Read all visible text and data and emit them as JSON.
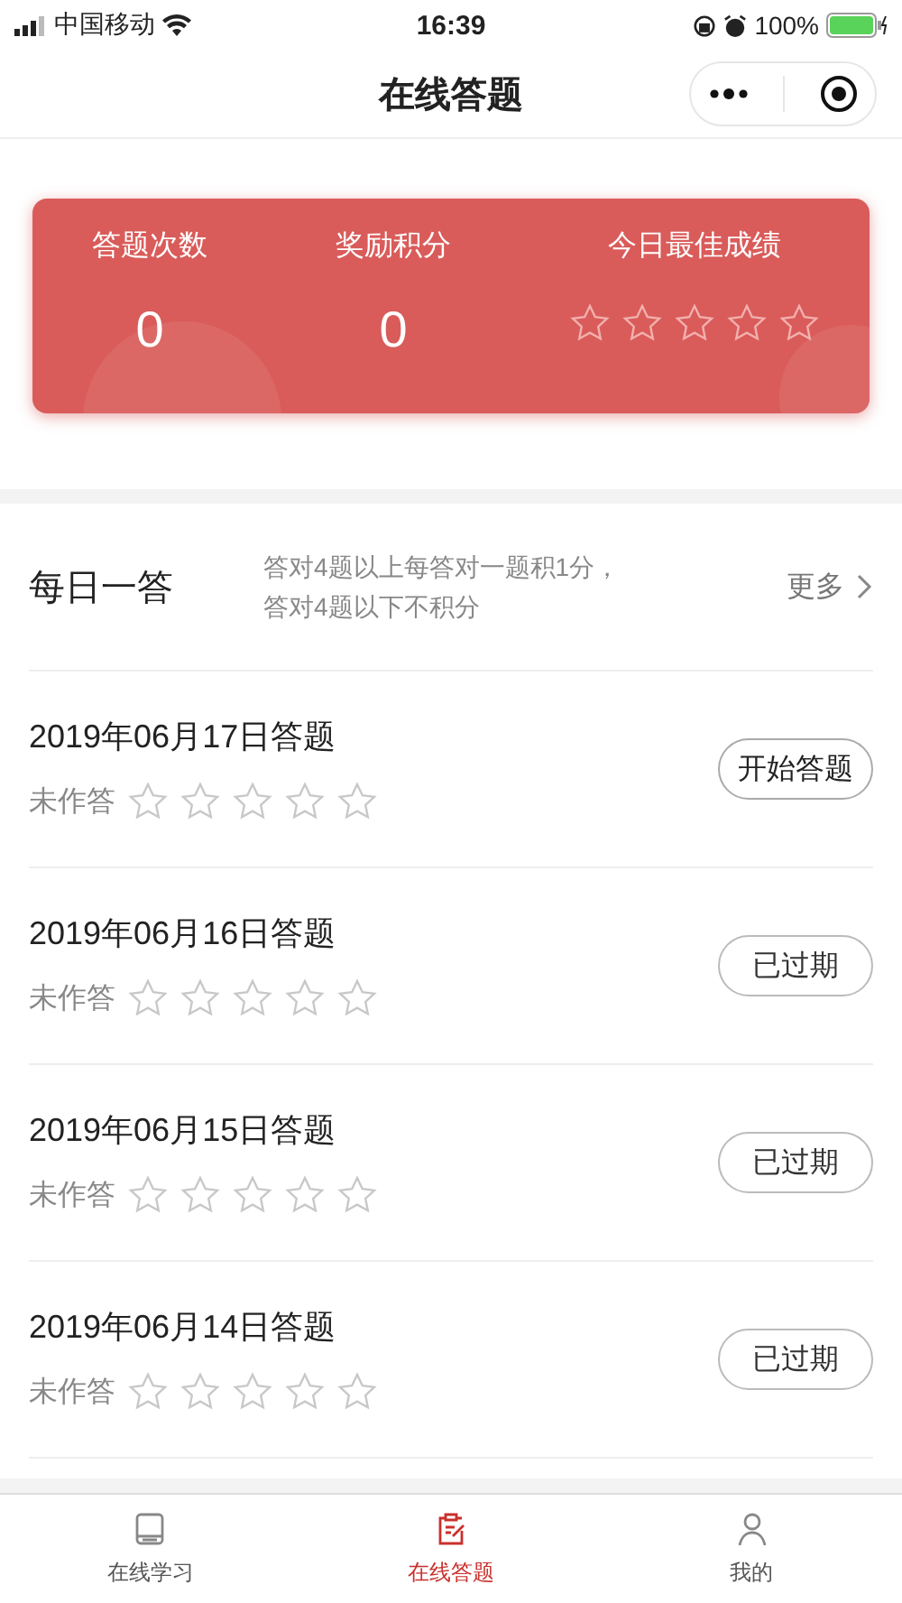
{
  "status_bar": {
    "carrier": "中国移动",
    "time": "16:39",
    "battery": "100%"
  },
  "nav": {
    "title": "在线答题"
  },
  "summary": {
    "stats": [
      {
        "label": "答题次数",
        "value": "0"
      },
      {
        "label": "奖励积分",
        "value": "0"
      }
    ],
    "best": {
      "label": "今日最佳成绩",
      "stars": 0
    }
  },
  "daily": {
    "title": "每日一答",
    "rule_lines": [
      "答对4题以上每答对一题积1分，",
      "答对4题以下不积分"
    ],
    "more": "更多"
  },
  "quizzes": [
    {
      "title": "2019年06月17日答题",
      "status": "未作答",
      "stars": 0,
      "button": "开始答题",
      "kind": "open"
    },
    {
      "title": "2019年06月16日答题",
      "status": "未作答",
      "stars": 0,
      "button": "已过期",
      "kind": "expired"
    },
    {
      "title": "2019年06月15日答题",
      "status": "未作答",
      "stars": 0,
      "button": "已过期",
      "kind": "expired"
    },
    {
      "title": "2019年06月14日答题",
      "status": "未作答",
      "stars": 0,
      "button": "已过期",
      "kind": "expired"
    }
  ],
  "tab_bar": [
    {
      "label": "在线学习",
      "selected": false
    },
    {
      "label": "在线答题",
      "selected": true
    },
    {
      "label": "我的",
      "selected": false
    }
  ]
}
